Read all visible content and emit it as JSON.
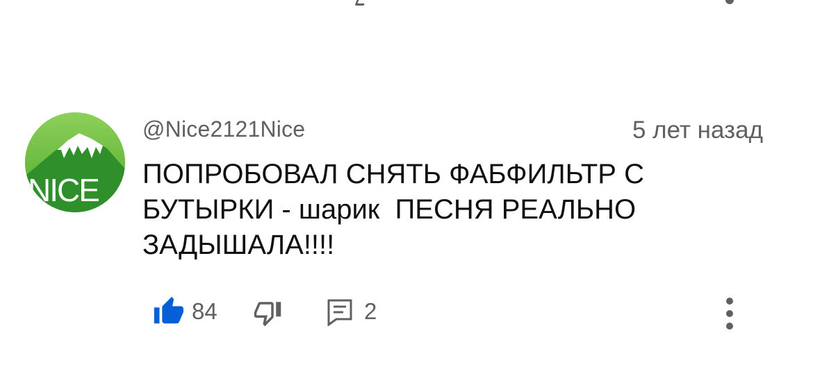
{
  "comment": {
    "author": "@Nice2121Nice",
    "timestamp": "5 лет назад",
    "text": "ПОПРОБОВАЛ СНЯТЬ ФАБФИЛЬТР С БУТЫРКИ - шарик  ПЕСНЯ РЕАЛЬНО ЗАДЫШАЛА!!!!",
    "avatar_text": "NICE",
    "like_count": "84",
    "reply_count": "2",
    "liked": true
  },
  "icons": {
    "like": "thumbs-up-icon",
    "dislike": "thumbs-down-icon",
    "reply": "reply-comment-icon",
    "more": "more-vert-icon"
  },
  "colors": {
    "liked_blue": "#065fd4",
    "meta_gray": "#606060",
    "avatar_green": "#67b93a"
  }
}
